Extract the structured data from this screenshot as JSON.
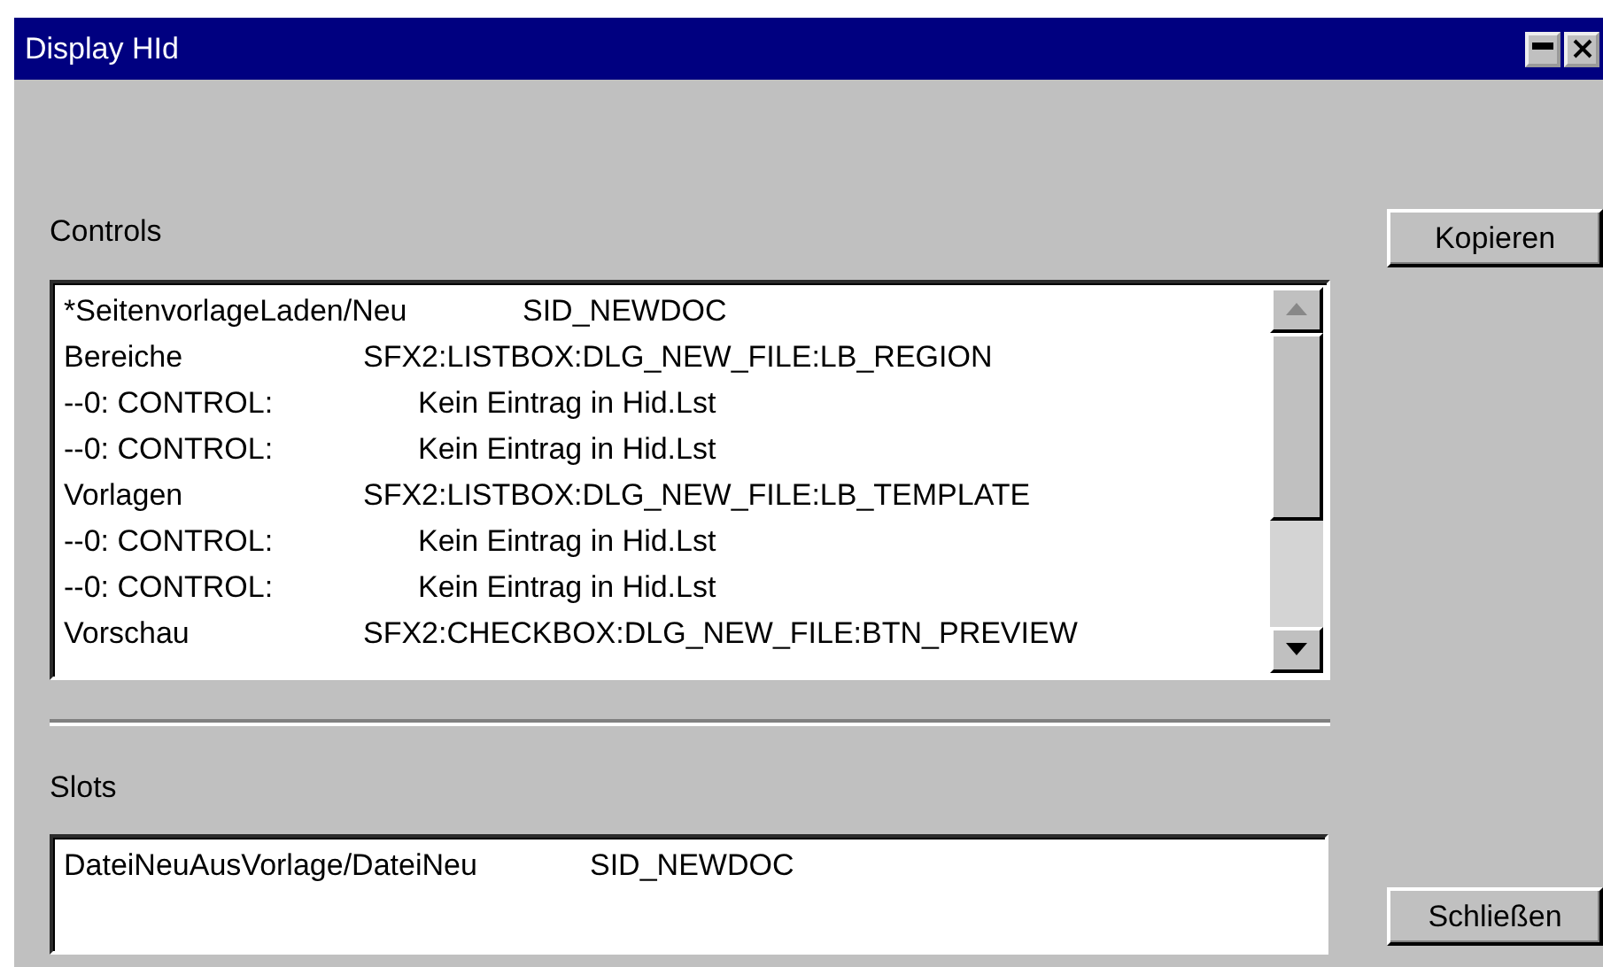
{
  "window": {
    "title": "Display HId"
  },
  "controls": {
    "label": "Controls",
    "rows": [
      {
        "kind": "head",
        "name": "*SeitenvorlageLaden/Neu",
        "value": "SID_NEWDOC"
      },
      {
        "kind": "control",
        "name": "Bereiche",
        "value": "SFX2:LISTBOX:DLG_NEW_FILE:LB_REGION"
      },
      {
        "kind": "missing",
        "name": "--0: CONTROL:",
        "value": "Kein Eintrag in Hid.Lst"
      },
      {
        "kind": "missing",
        "name": "--0: CONTROL:",
        "value": "Kein Eintrag in Hid.Lst"
      },
      {
        "kind": "control",
        "name": "Vorlagen",
        "value": "SFX2:LISTBOX:DLG_NEW_FILE:LB_TEMPLATE"
      },
      {
        "kind": "missing",
        "name": "--0: CONTROL:",
        "value": "Kein Eintrag in Hid.Lst"
      },
      {
        "kind": "missing",
        "name": "--0: CONTROL:",
        "value": "Kein Eintrag in Hid.Lst"
      },
      {
        "kind": "control",
        "name": "Vorschau",
        "value": "SFX2:CHECKBOX:DLG_NEW_FILE:BTN_PREVIEW"
      }
    ]
  },
  "slots": {
    "label": "Slots",
    "rows": [
      {
        "kind": "slot",
        "name": "DateiNeuAusVorlage/DateiNeu",
        "value": "SID_NEWDOC"
      }
    ]
  },
  "buttons": [
    "Kopieren",
    "Schließen"
  ]
}
